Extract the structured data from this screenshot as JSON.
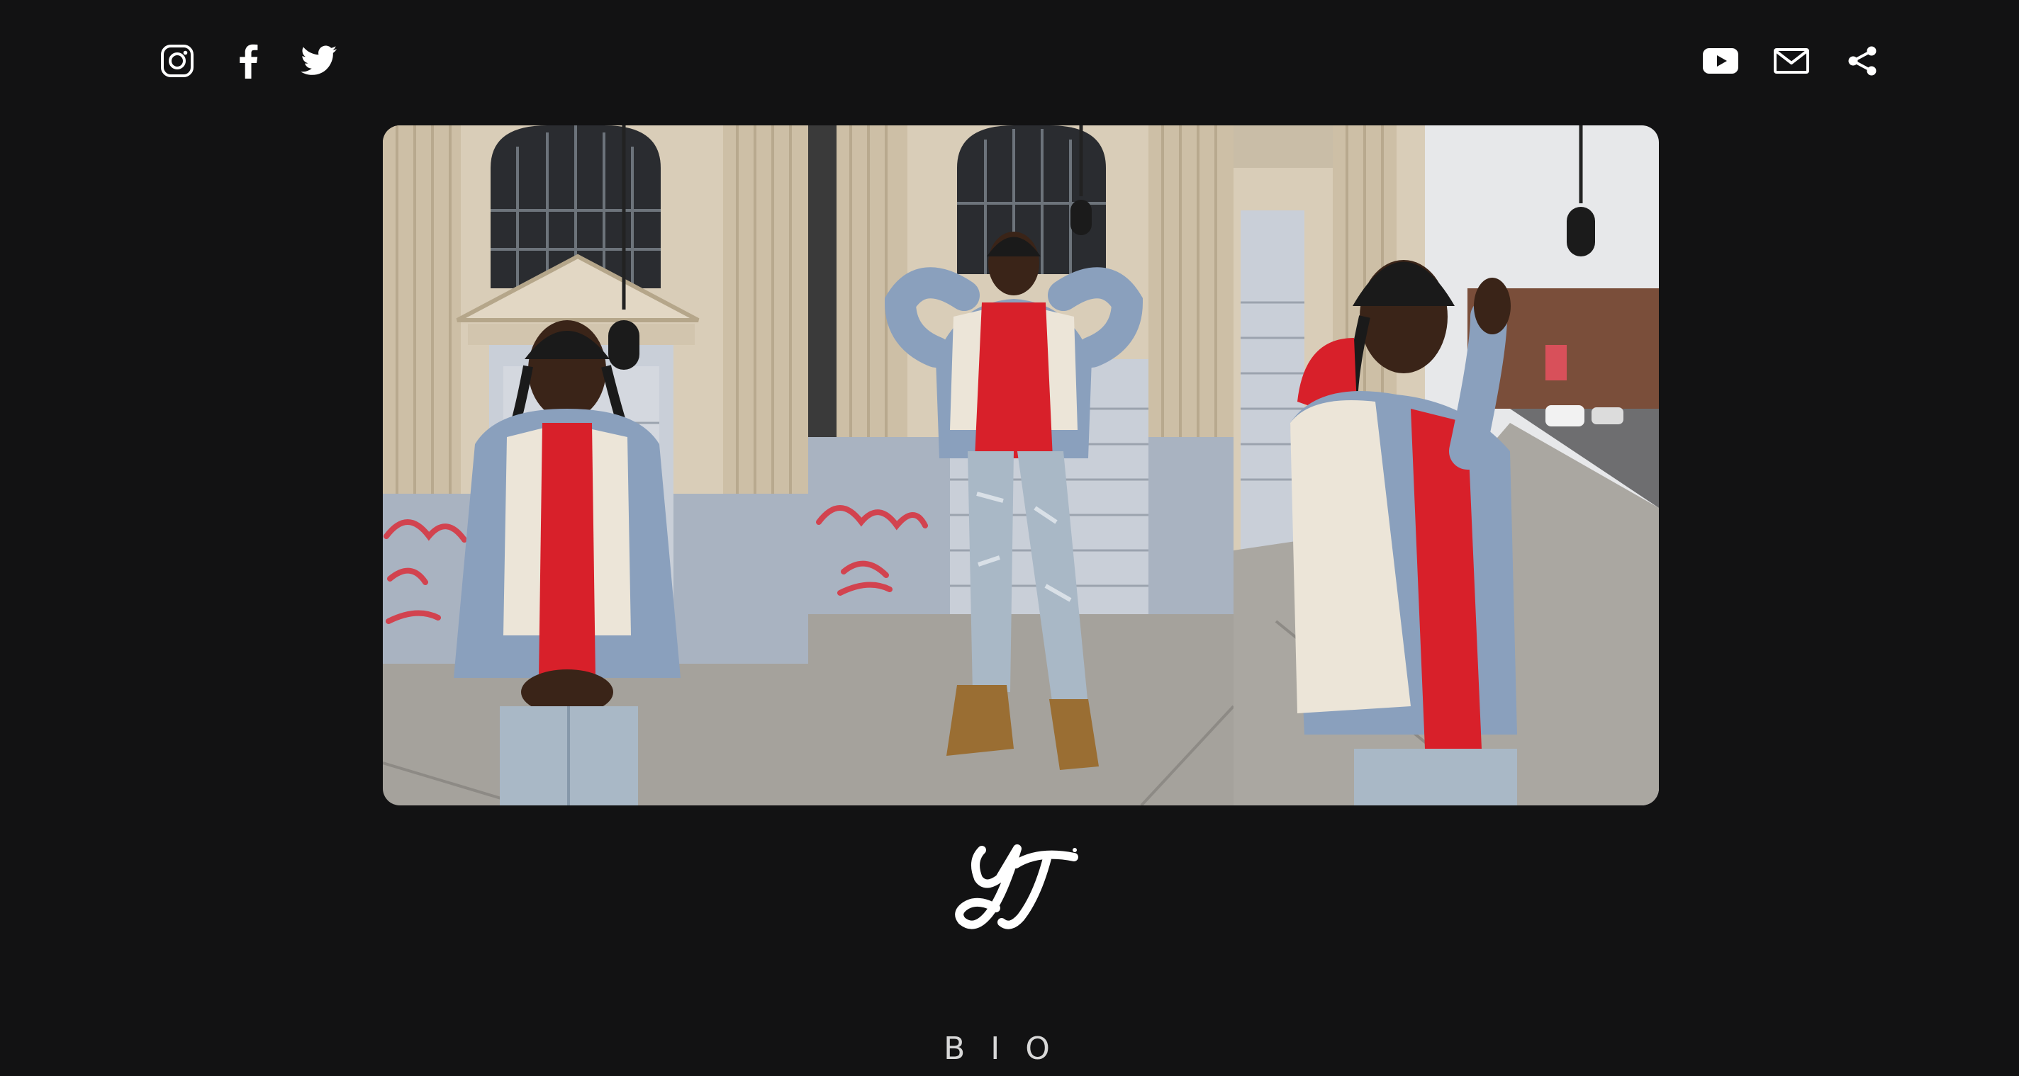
{
  "header": {
    "social_left": [
      {
        "name": "instagram",
        "icon": "instagram-icon"
      },
      {
        "name": "facebook",
        "icon": "facebook-icon"
      },
      {
        "name": "twitter",
        "icon": "twitter-icon"
      }
    ],
    "social_right": [
      {
        "name": "youtube",
        "icon": "youtube-icon"
      },
      {
        "name": "email",
        "icon": "mail-icon"
      },
      {
        "name": "share",
        "icon": "share-icon"
      }
    ]
  },
  "hero": {
    "panels": [
      {
        "description_icon": "photo-panel-1"
      },
      {
        "description_icon": "photo-panel-2"
      },
      {
        "description_icon": "photo-panel-3"
      }
    ]
  },
  "logo": {
    "icon": "yt-monogram-logo"
  },
  "section": {
    "bio_heading": "BIO"
  },
  "colors": {
    "background": "#121213",
    "icon": "#ffffff",
    "hoodie_red": "#d8202a",
    "denim": "#8aa0bd",
    "wall": "#d9cdb8"
  }
}
